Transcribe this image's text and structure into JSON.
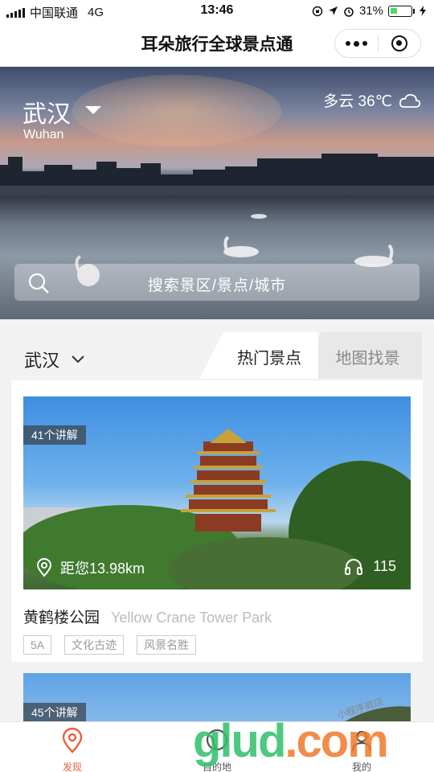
{
  "status_bar": {
    "carrier": "中国联通",
    "network": "4G",
    "time": "13:46",
    "battery": "31%"
  },
  "nav": {
    "title": "耳朵旅行全球景点通"
  },
  "hero": {
    "city_cn": "武汉",
    "city_en": "Wuhan",
    "weather": "多云 36℃",
    "search_placeholder": "搜索景区/景点/城市"
  },
  "filter": {
    "city": "武汉",
    "tabs": [
      {
        "label": "热门景点",
        "active": true
      },
      {
        "label": "地图找景",
        "active": false
      }
    ]
  },
  "cards": [
    {
      "badge": "41个讲解",
      "distance": "距您13.98km",
      "listen_count": "115",
      "name_cn": "黄鹤楼公园",
      "name_en": "Yellow Crane Tower Park",
      "tags": [
        "5A",
        "文化古迹",
        "风景名胜"
      ]
    },
    {
      "badge": "45个讲解"
    }
  ],
  "tabbar": {
    "items": [
      {
        "label": "发现",
        "icon": "location-pin-icon",
        "active": true
      },
      {
        "label": "目的地",
        "icon": "globe-icon",
        "active": false
      },
      {
        "label": "我的",
        "icon": "user-icon",
        "active": false
      }
    ]
  },
  "watermark": {
    "main": "glud",
    "suffix": ".com",
    "small": "小程序商店"
  },
  "colors": {
    "accent": "#e8603c",
    "watermark_green": "#2fbf6a"
  }
}
